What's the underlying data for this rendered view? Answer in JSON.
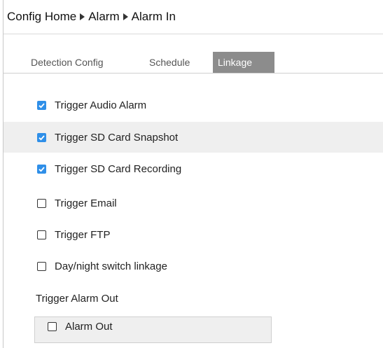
{
  "breadcrumb": {
    "items": [
      "Config Home",
      "Alarm",
      "Alarm In"
    ]
  },
  "tabs": [
    {
      "label": "Detection Config",
      "active": false
    },
    {
      "label": "Schedule",
      "active": false
    },
    {
      "label": "Linkage",
      "active": true
    }
  ],
  "linkage": {
    "options": [
      {
        "label": "Trigger Audio Alarm",
        "checked": true
      },
      {
        "label": "Trigger SD Card Snapshot",
        "checked": true
      },
      {
        "label": "Trigger SD Card Recording",
        "checked": true
      },
      {
        "label": "Trigger Email",
        "checked": false
      },
      {
        "label": "Trigger FTP",
        "checked": false
      },
      {
        "label": "Day/night switch linkage",
        "checked": false
      }
    ],
    "alarm_out_section": "Trigger Alarm Out",
    "alarm_out_item": {
      "label": "Alarm Out",
      "checked": false
    }
  },
  "colors": {
    "checkbox_checked": "#2f8fe8",
    "active_tab": "#8c8c8c",
    "shaded_row": "#efefef"
  }
}
